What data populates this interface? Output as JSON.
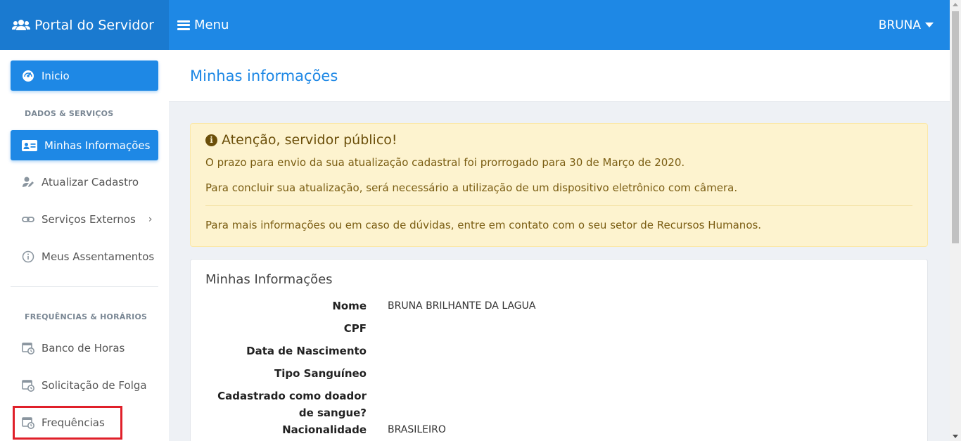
{
  "header": {
    "brand": "Portal do Servidor",
    "menu_label": "Menu",
    "user": "BRUNA"
  },
  "sidebar": {
    "home": "Inicio",
    "section1": "DADOS & SERVIÇOS",
    "items1": [
      {
        "label": "Minhas Informações",
        "icon": "id-card-icon",
        "active": true
      },
      {
        "label": "Atualizar Cadastro",
        "icon": "user-edit-icon"
      },
      {
        "label": "Serviços Externos",
        "icon": "link-icon"
      },
      {
        "label": "Meus Assentamentos",
        "icon": "info-circle-icon"
      }
    ],
    "section2": "FREQUÊNCIAS & HORÁRIOS",
    "items2": [
      {
        "label": "Banco de Horas",
        "icon": "calendar-clock-icon"
      },
      {
        "label": "Solicitação de Folga",
        "icon": "calendar-clock-icon"
      },
      {
        "label": "Frequências",
        "icon": "calendar-clock-icon"
      }
    ]
  },
  "page": {
    "title": "Minhas informações"
  },
  "alert": {
    "title": "Atenção, servidor público!",
    "line1": "O prazo para envio da sua atualização cadastral foi prorrogado para 30 de Março de 2020.",
    "line2": "Para concluir sua atualização, será necessário a utilização de um dispositivo eletrônico com câmera.",
    "line3": "Para mais informações ou em caso de dúvidas, entre em contato com o seu setor de Recursos Humanos."
  },
  "info_card": {
    "title": "Minhas Informações",
    "rows": [
      {
        "label": "Nome",
        "value": "BRUNA BRILHANTE DA LAGUA"
      },
      {
        "label": "CPF",
        "value": ""
      },
      {
        "label": "Data de Nascimento",
        "value": ""
      },
      {
        "label": "Tipo Sanguíneo",
        "value": ""
      },
      {
        "label": "Cadastrado como doador",
        "label2": "de sangue?",
        "value": ""
      },
      {
        "label": "Nacionalidade",
        "value": "BRASILEIRO"
      }
    ]
  },
  "colors": {
    "primary": "#1e88e5",
    "alert_bg": "#fdf3cf",
    "highlight": "#e0202a"
  }
}
